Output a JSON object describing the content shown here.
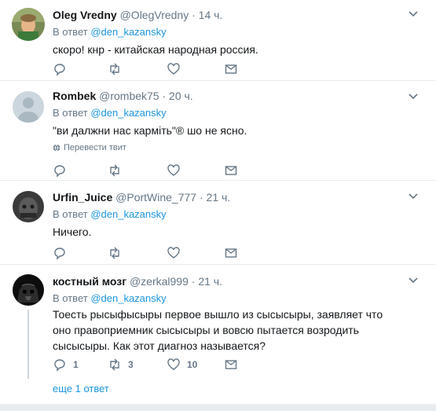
{
  "reply_prefix": "В ответ",
  "tweets": [
    {
      "name": "Oleg Vredny",
      "handle": "@OlegVredny",
      "time": "14 ч.",
      "reply_to": "@den_kazansky",
      "text": "скоро! кнр - китайская народная россия.",
      "reply_count": "",
      "retweet_count": "",
      "like_count": ""
    },
    {
      "name": "Rombek",
      "handle": "@rombek75",
      "time": "20 ч.",
      "reply_to": "@den_kazansky",
      "text": "\"ви далжни нас карміть\"® шо не ясно.",
      "translate_label": "Перевести твит",
      "reply_count": "",
      "retweet_count": "",
      "like_count": ""
    },
    {
      "name": "Urfin_Juice",
      "handle": "@PortWine_777",
      "time": "21 ч.",
      "reply_to": "@den_kazansky",
      "text": "Ничего.",
      "reply_count": "",
      "retweet_count": "",
      "like_count": ""
    },
    {
      "name": "костный мозг",
      "handle": "@zerkal999",
      "time": "21 ч.",
      "reply_to": "@den_kazansky",
      "text": "Тоесть рысыфысыры первое вышло из сысысыры, заявляет что оно правоприемник сысысыры и вовсю пытается возродить сысысыры. Как этот диагноз называется?",
      "reply_count": "1",
      "retweet_count": "3",
      "like_count": "10"
    }
  ],
  "more_replies_label": "еще 1 ответ",
  "colors": {
    "link": "#1b95e0",
    "muted": "#657786",
    "text": "#14171a",
    "divider": "#e6ecf0",
    "thread_line": "#ccd6dd"
  },
  "icons": [
    "chevron-down-icon",
    "reply-icon",
    "retweet-icon",
    "like-icon",
    "dm-icon",
    "globe-icon"
  ]
}
